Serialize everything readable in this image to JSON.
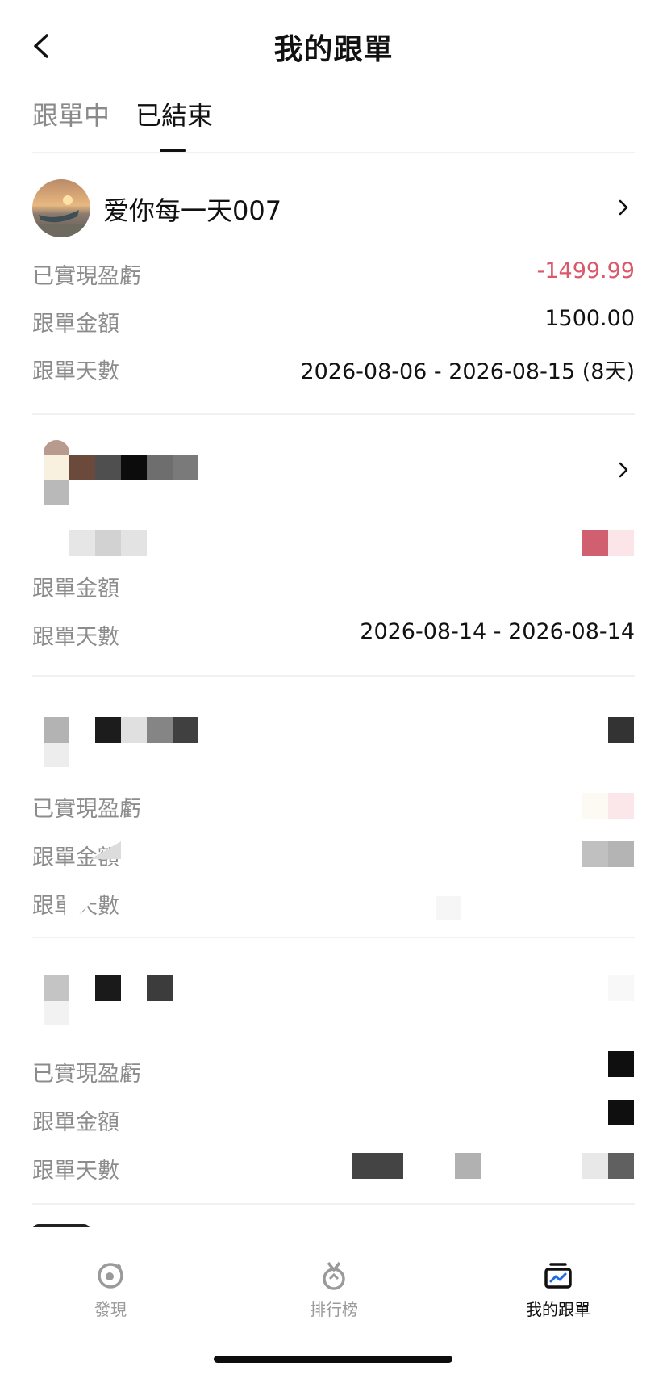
{
  "header": {
    "title": "我的跟單"
  },
  "tabs": [
    {
      "label": "跟單中",
      "active": false
    },
    {
      "label": "已結束",
      "active": true
    }
  ],
  "cards": [
    {
      "trader_name": "爱你每一天007",
      "rows": [
        {
          "label": "已實現盈虧",
          "value": "-1499.99"
        },
        {
          "label": "跟單金額",
          "value": "1500.00"
        },
        {
          "label": "跟單天數",
          "value": "2026-08-06 - 2026-08-15 (8天)"
        }
      ]
    },
    {
      "trader_name": "",
      "rows": [
        {
          "label": "跟單金額",
          "value": ""
        },
        {
          "label": "跟單天數",
          "value": "2026-08-14 - 2026-08-14"
        }
      ]
    },
    {
      "trader_name": "",
      "rows": [
        {
          "label": "已實現盈虧",
          "value": ""
        },
        {
          "label": "跟單金額",
          "value": ""
        },
        {
          "label": "跟單天數",
          "value": ""
        }
      ]
    },
    {
      "trader_name": "",
      "rows": [
        {
          "label": "已實現盈虧",
          "value": ""
        },
        {
          "label": "跟單金額",
          "value": ""
        },
        {
          "label": "跟單天數",
          "value": ""
        }
      ]
    }
  ],
  "bottom_nav": [
    {
      "label": "發現",
      "icon": "discover-icon",
      "active": false
    },
    {
      "label": "排行榜",
      "icon": "ranking-medal-icon",
      "active": false
    },
    {
      "label": "我的跟單",
      "icon": "my-copy-trade-icon",
      "active": true
    }
  ],
  "colors": {
    "loss": "#d9596b",
    "text": "#111111",
    "muted": "#8c8c8c"
  }
}
